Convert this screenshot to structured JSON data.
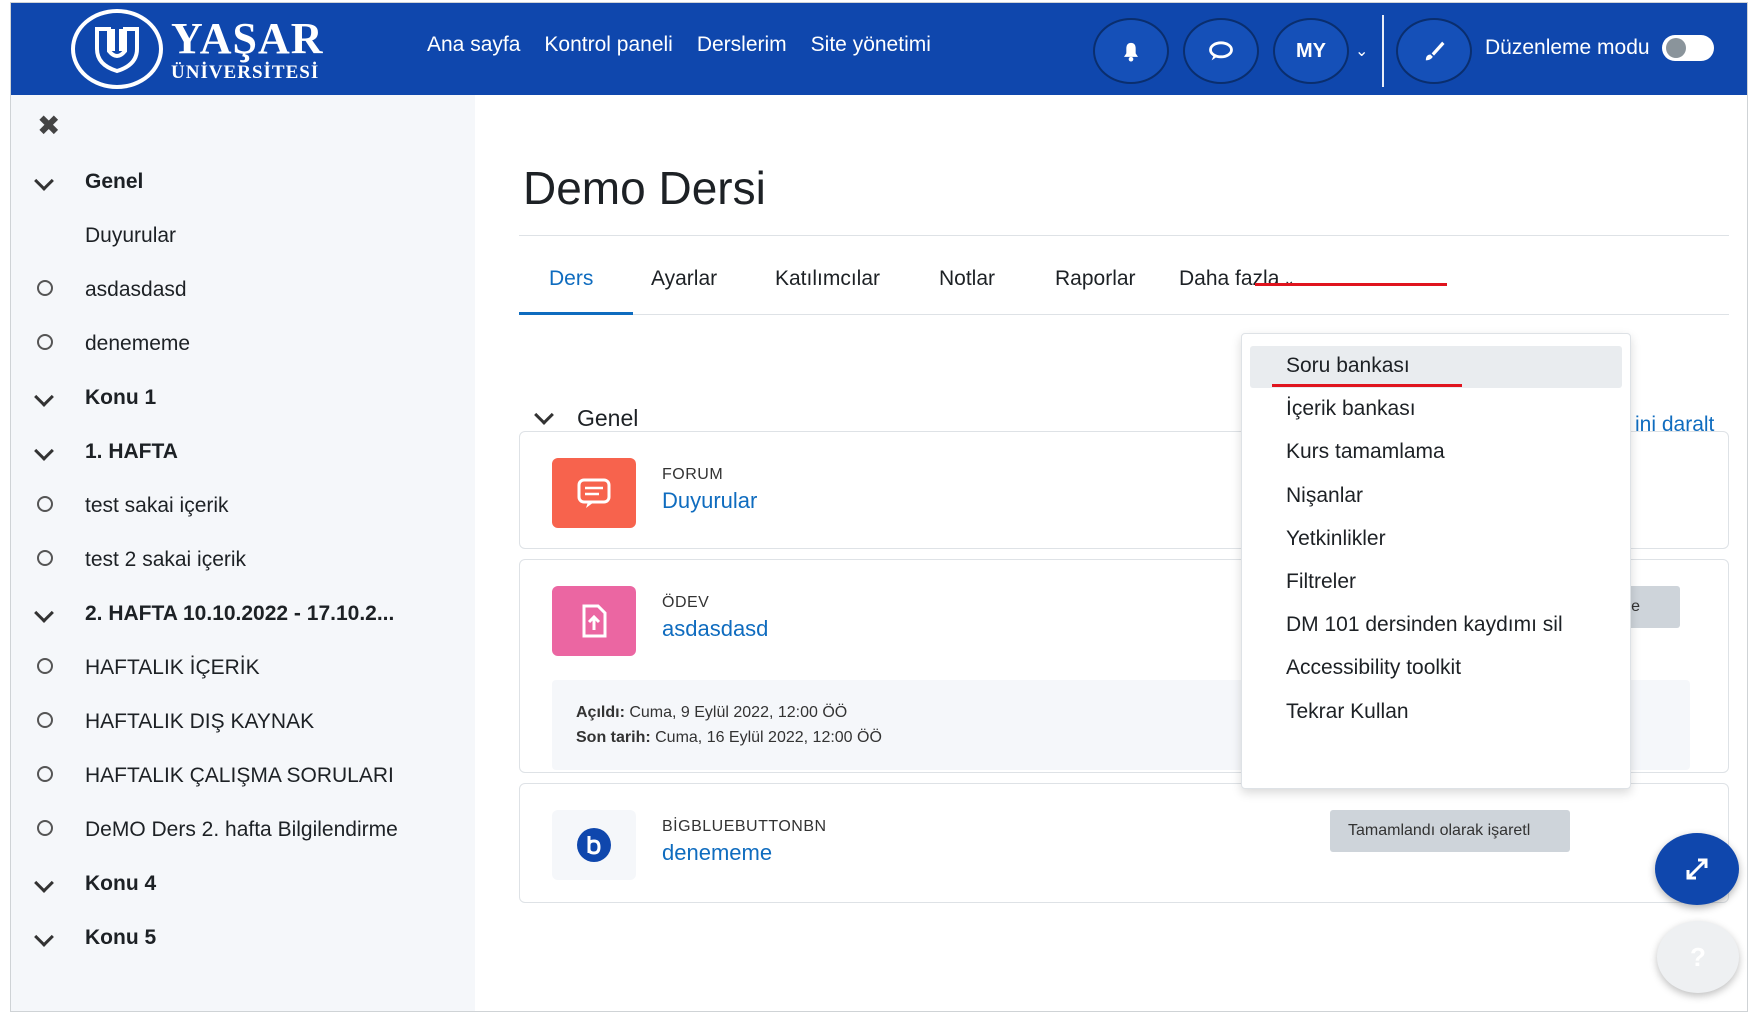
{
  "brand": {
    "name_line1": "YAŞAR",
    "name_line2": "ÜNİVERSİTESİ"
  },
  "topnav": [
    "Ana sayfa",
    "Kontrol paneli",
    "Derslerim",
    "Site yönetimi"
  ],
  "user": {
    "initials": "MY"
  },
  "edit_mode": {
    "label": "Düzenleme modu",
    "enabled": false
  },
  "drawer": {
    "items": [
      {
        "label": "Genel",
        "kind": "section"
      },
      {
        "label": "Duyurular",
        "kind": "plain"
      },
      {
        "label": "asdasdasd",
        "kind": "activity"
      },
      {
        "label": "denememe",
        "kind": "activity"
      },
      {
        "label": "Konu 1",
        "kind": "section"
      },
      {
        "label": "1. HAFTA",
        "kind": "section"
      },
      {
        "label": "test sakai içerik",
        "kind": "activity"
      },
      {
        "label": "test 2 sakai içerik",
        "kind": "activity"
      },
      {
        "label": "2. HAFTA 10.10.2022 - 17.10.2...",
        "kind": "section"
      },
      {
        "label": "HAFTALIK İÇERİK",
        "kind": "activity"
      },
      {
        "label": "HAFTALIK DIŞ KAYNAK",
        "kind": "activity"
      },
      {
        "label": "HAFTALIK ÇALIŞMA SORULARI",
        "kind": "activity"
      },
      {
        "label": "DeMO Ders 2. hafta Bilgilendirme",
        "kind": "activity"
      },
      {
        "label": "Konu 4",
        "kind": "section"
      },
      {
        "label": "Konu 5",
        "kind": "section"
      }
    ]
  },
  "course": {
    "title": "Demo Dersi"
  },
  "tabs": {
    "ders": "Ders",
    "ayarlar": "Ayarlar",
    "katilimcilar": "Katılımcılar",
    "notlar": "Notlar",
    "raporlar": "Raporlar",
    "daha_fazla": "Daha fazla"
  },
  "section": {
    "title": "Genel",
    "collapse_link": "ini daralt"
  },
  "activities": {
    "forum": {
      "type": "FORUM",
      "name": "Duyurular",
      "color": "#f7634d"
    },
    "assign": {
      "type": "ÖDEV",
      "name": "asdasdasd",
      "color": "#eb66a2",
      "opened_label": "Açıldı:",
      "opened_value": " Cuma, 9 Eylül 2022, 12:00 ÖÖ",
      "due_label": "Son tarih:",
      "due_value": " Cuma, 16 Eylül 2022, 12:00 ÖÖ",
      "mark_button": "aretle"
    },
    "bbb": {
      "type": "BİGBLUEBUTTONBN",
      "name": "denememe",
      "mark_button": "Tamamlandı olarak işaretl"
    }
  },
  "dropdown": {
    "items": [
      "Soru bankası",
      "İçerik bankası",
      "Kurs tamamlama",
      "Nişanlar",
      "Yetkinlikler",
      "Filtreler",
      "DM 101 dersinden kaydımı sil",
      "Accessibility toolkit",
      "Tekrar Kullan"
    ]
  },
  "help_fab": {
    "label": "?"
  },
  "colors": {
    "navbar": "#0f47ad",
    "link": "#0f6cbf",
    "highlight_red": "#e0141e"
  }
}
